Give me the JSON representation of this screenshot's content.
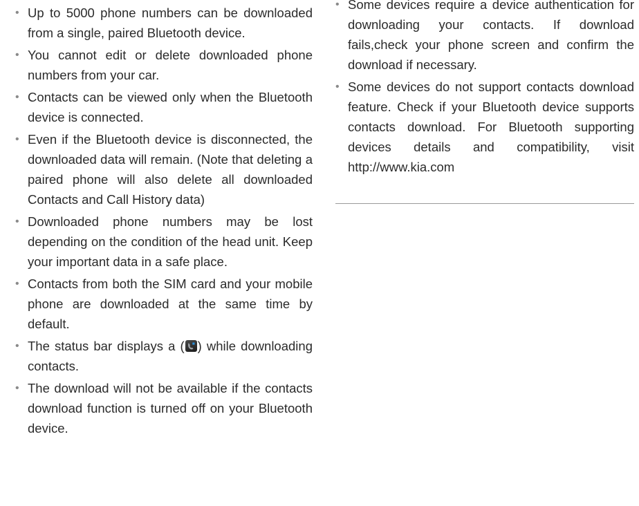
{
  "left_column": {
    "items": [
      "Up to 5000 phone numbers can be downloaded from a single, paired Bluetooth device.",
      "You cannot edit or delete downloaded phone numbers from your car.",
      "Contacts can be viewed only when the Bluetooth device is connected.",
      "Even if the Bluetooth device is disconnected, the downloaded data will remain. (Note that deleting a paired phone will also delete all downloaded Contacts and Call History data)",
      "Downloaded phone numbers may be lost depending on the condition of the head unit. Keep your important data in a safe place.",
      "Contacts from both the SIM card and your mobile phone are downloaded at the same time by default."
    ],
    "status_item": {
      "before": "The status bar displays a (",
      "after": ") while downloading contacts.",
      "icon": "contacts-download-icon"
    },
    "last_item": "The download will not be available if the contacts download function is turned off on your Bluetooth device."
  },
  "right_column": {
    "items": [
      "Some devices require a device authentication for downloading your contacts. If download fails,check your phone screen and confirm the download if necessary.",
      "Some devices do not support contacts download feature. Check if your Bluetooth device supports contacts download. For Bluetooth supporting devices details and compatibility, visit http://www.kia.com"
    ]
  },
  "bullet_char": "•"
}
